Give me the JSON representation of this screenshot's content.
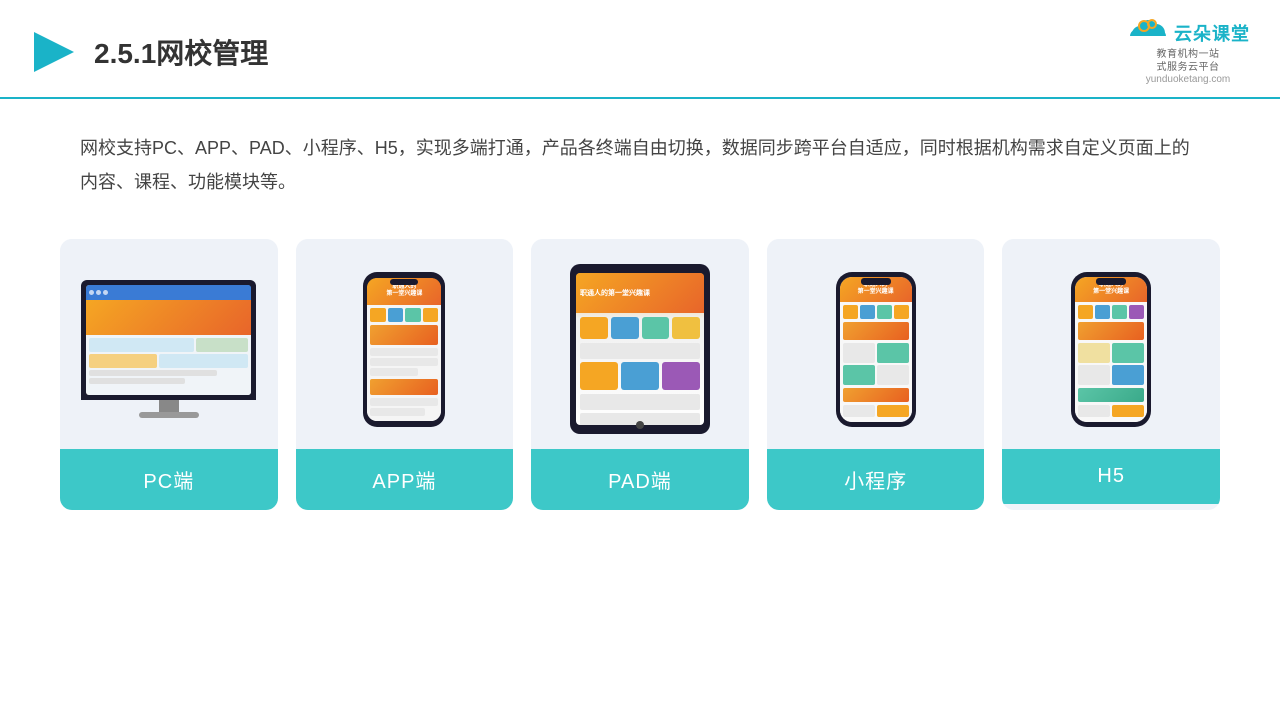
{
  "header": {
    "title_prefix": "2.5.1",
    "title_main": "网校管理",
    "logo_cn": "云朵课堂",
    "logo_url": "yunduoketang.com",
    "logo_sub": "教育机构一站\n式服务云平台"
  },
  "description": {
    "text": "网校支持PC、APP、PAD、小程序、H5，实现多端打通，产品各终端自由切换，数据同步跨平台自适应，同时根据机构需求自定义页面上的内容、课程、功能模块等。"
  },
  "cards": [
    {
      "id": "pc",
      "label": "PC端"
    },
    {
      "id": "app",
      "label": "APP端"
    },
    {
      "id": "pad",
      "label": "PAD端"
    },
    {
      "id": "miniprogram",
      "label": "小程序"
    },
    {
      "id": "h5",
      "label": "H5"
    }
  ],
  "colors": {
    "accent": "#1ab3c8",
    "card_bg": "#eef2f8",
    "label_bg": "#3dc8c8",
    "header_border": "#1ab3c8"
  }
}
